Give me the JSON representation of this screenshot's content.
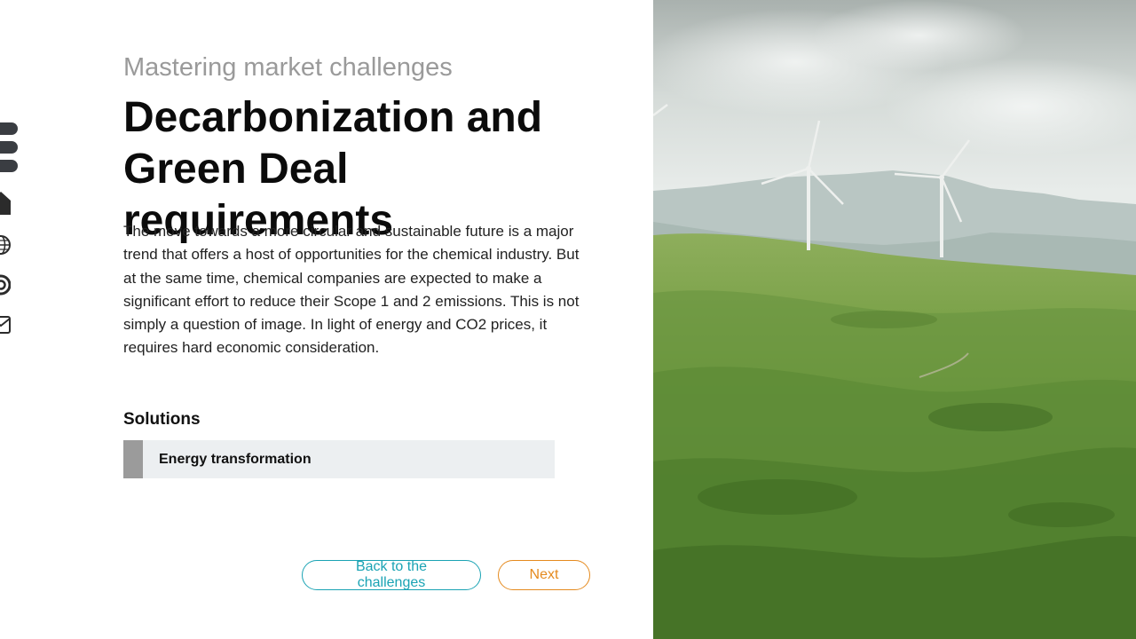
{
  "rail": {
    "icons": [
      "menu-icon",
      "home-icon",
      "globe-icon",
      "target-icon",
      "mail-icon"
    ]
  },
  "header": {
    "subtitle": "Mastering market challenges",
    "title": "Decarbonization and Green Deal requirements"
  },
  "main": {
    "body": "The move towards a more circular and sustainable future is a major trend that offers a host of opportunities for the chemical industry. But at the same time, chemical companies are expected to make a significant effort to reduce their Scope 1 and 2 emissions. This is not simply a question of image. In light of energy and CO2 prices, it requires hard economic consideration.",
    "solutions_heading": "Solutions",
    "solutions": [
      {
        "label": "Energy transformation"
      }
    ]
  },
  "nav": {
    "back_label": "Back to the challenges",
    "next_label": "Next"
  },
  "colors": {
    "accent_teal": "#1aa3b4",
    "accent_orange": "#e58a1e",
    "solution_bg": "#eceff1",
    "solution_bar": "#9b9b9b"
  },
  "hero": {
    "subject": "green rolling hills with wind turbines"
  }
}
